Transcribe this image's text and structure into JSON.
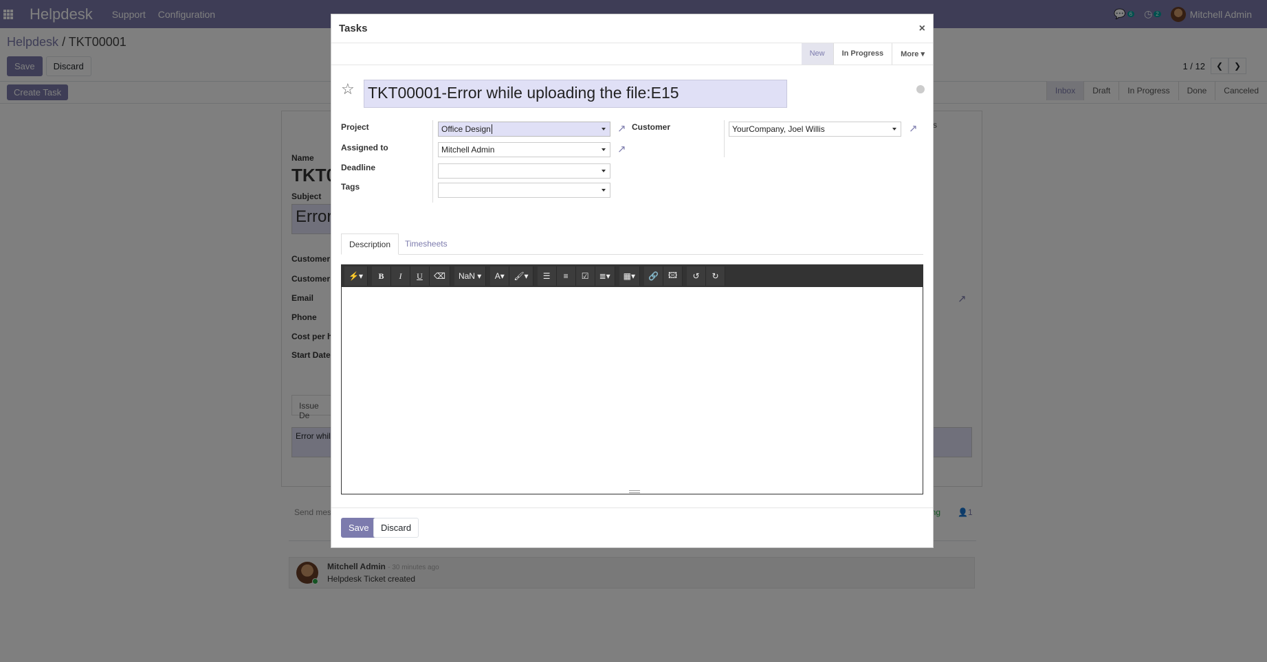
{
  "topbar": {
    "app_name": "Helpdesk",
    "menu": [
      "Support",
      "Configuration"
    ],
    "messages_count": "6",
    "activities_count": "2",
    "user_name": "Mitchell Admin"
  },
  "breadcrumb": {
    "parent": "Helpdesk",
    "sep": "/",
    "current": "TKT00001"
  },
  "control": {
    "save": "Save",
    "discard": "Discard",
    "pager": "1 / 12",
    "create_task": "Create Task"
  },
  "ticket_stages": [
    "Inbox",
    "Draft",
    "In Progress",
    "Done",
    "Canceled"
  ],
  "ticket_sheet": {
    "name_label": "Name",
    "name_value": "TKT0",
    "subject_label": "Subject",
    "subject_value": "Error",
    "labels": [
      "Customer",
      "Customer",
      "Email",
      "Phone",
      "Cost per h",
      "Start Date"
    ],
    "tab": "Issue De",
    "desc": "Error while",
    "tasks_frag": "sks"
  },
  "chatter": {
    "send_message": "Send mes",
    "following": "ing",
    "followers": "1",
    "author": "Mitchell Admin",
    "when": "- 30 minutes ago",
    "body": "Helpdesk Ticket created"
  },
  "modal": {
    "title": "Tasks",
    "close": "×",
    "stages": {
      "new": "New",
      "in_progress": "In Progress",
      "more": "More"
    },
    "task_title": "TKT00001-Error while uploading the file:E15",
    "fields": {
      "project_label": "Project",
      "project_value": "Office Design",
      "assigned_label": "Assigned to",
      "assigned_value": "Mitchell Admin",
      "deadline_label": "Deadline",
      "deadline_value": "",
      "tags_label": "Tags",
      "tags_value": "",
      "customer_label": "Customer",
      "customer_value": "YourCompany, Joel Willis"
    },
    "tabs": {
      "description": "Description",
      "timesheets": "Timesheets"
    },
    "toolbar": {
      "font_size": "NaN"
    },
    "footer": {
      "save": "Save",
      "discard": "Discard"
    }
  },
  "colors": {
    "brand": "#7c7bad",
    "overlay": "rgba(0,0,0,0.5)"
  }
}
